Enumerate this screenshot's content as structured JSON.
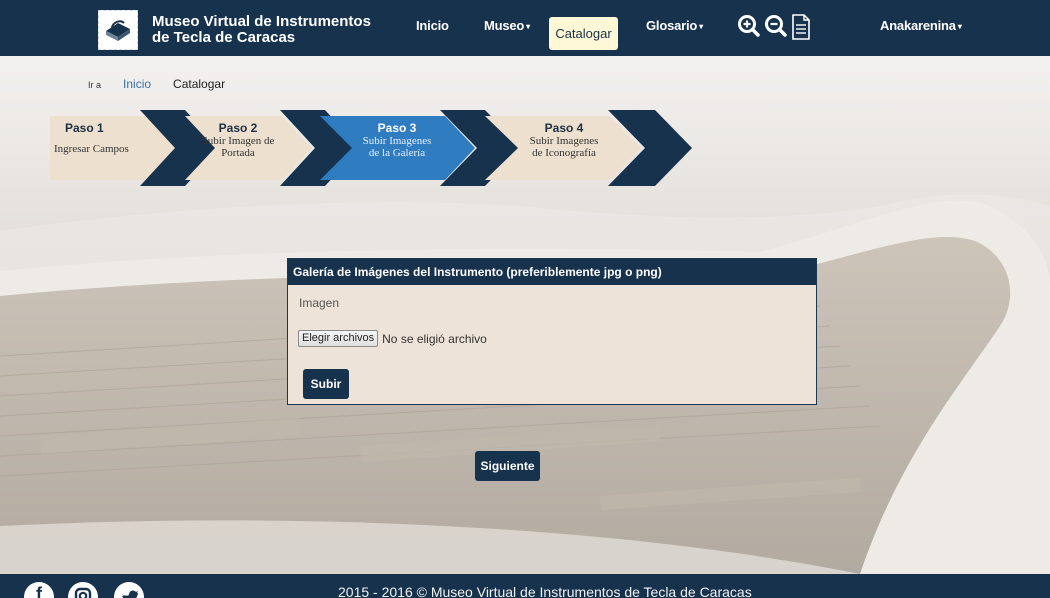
{
  "brand": {
    "title_line1": "Museo Virtual de Instrumentos",
    "title_line2": "de Tecla de Caracas",
    "logo_icon": "museum-logo-icon"
  },
  "nav": {
    "inicio": "Inicio",
    "museo": "Museo",
    "catalogar": "Catalogar",
    "glosario": "Glosario",
    "user": "Anakarenina",
    "caret": "▾",
    "tools": [
      "zoom-in-icon",
      "zoom-out-icon",
      "document-icon"
    ]
  },
  "breadcrumb": {
    "prefix": "Ir a",
    "home": "Inicio",
    "current": "Catalogar"
  },
  "steps": [
    {
      "num": "Paso 1",
      "line1": "Ingresar Campos",
      "line2": ""
    },
    {
      "num": "Paso 2",
      "line1": "Subir Imagen de",
      "line2": "Portada"
    },
    {
      "num": "Paso 3",
      "line1": "Subir Imagenes",
      "line2": "de la Galería"
    },
    {
      "num": "Paso 4",
      "line1": "Subir Imagenes",
      "line2": "de Iconografía"
    }
  ],
  "active_step": 3,
  "panel": {
    "heading": "Galería de Imágenes del Instrumento (preferiblemente jpg o png)",
    "label": "Imagen",
    "file_button": "Elegir archivos",
    "file_status": "No se eligió archivo",
    "submit": "Subir"
  },
  "next_button": "Siguiente",
  "footer": {
    "text": "2015 - 2016 © Museo Virtual de Instrumentos de Tecla de Caracas",
    "social": [
      "facebook-icon",
      "instagram-icon",
      "twitter-icon"
    ]
  },
  "colors": {
    "navy": "#17324d",
    "step_beige": "#ede0cf",
    "step_active": "#2f7cc0",
    "highlight": "#fff8d6"
  }
}
